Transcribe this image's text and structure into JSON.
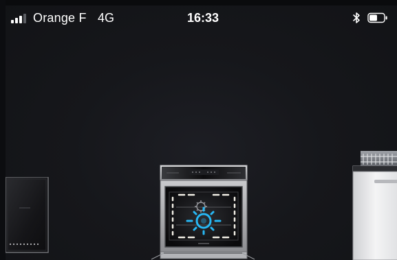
{
  "status_bar": {
    "carrier": "Orange F",
    "network": "4G",
    "time": "16:33",
    "signal_bars_filled": 3,
    "signal_bars_total": 4,
    "battery_level": 0.55,
    "icons": {
      "signal": "signal-strength-icon",
      "bluetooth": "bluetooth-icon",
      "battery": "battery-icon"
    }
  },
  "carousel": {
    "items": [
      {
        "id": "induction-hob",
        "icon": "induction-hob-icon"
      },
      {
        "id": "oven",
        "icon": "oven-icon",
        "selected": true
      },
      {
        "id": "dishwasher",
        "icon": "dishwasher-icon"
      }
    ]
  },
  "colors": {
    "background": "#16171b",
    "accent_blue": "#27b8f5",
    "status_text": "#ffffff",
    "oven_light": "#f2efe6"
  }
}
